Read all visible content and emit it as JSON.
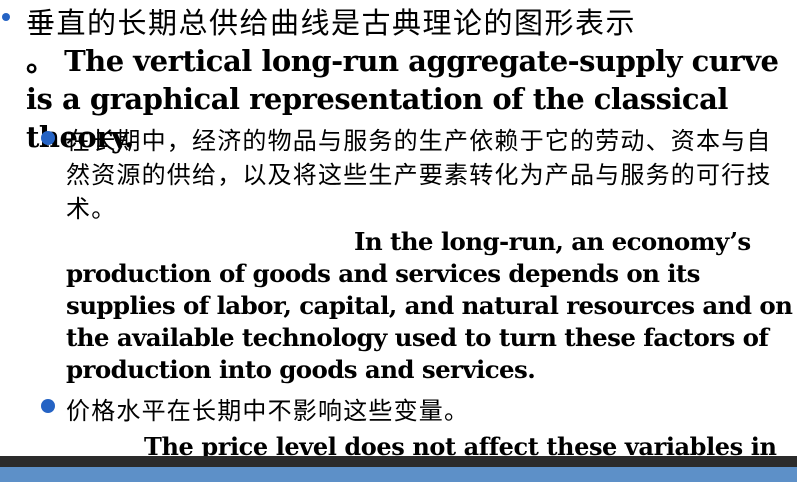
{
  "colors": {
    "bullet": "#2563c4",
    "footer_dark": "#2b2b2b",
    "footer_light": "#5d90c8",
    "text": "#000000"
  },
  "paragraph1": {
    "zh": "垂直的长期总供给曲线是古典理论的图形表示",
    "en": "。 The vertical long-run aggregate-supply curve is a graphical representation of the classical theory."
  },
  "paragraph2": {
    "zh": "在长期中，经济的物品与服务的生产依赖于它的劳动、资本与自然资源的供给，以及将这些生产要素转化为产品与服务的可行技术。",
    "en": "In the long-run, an economy’s production of goods and services depends on its supplies of labor, capital, and natural resources and on the available technology used to turn these factors of production into goods and services."
  },
  "paragraph3": {
    "zh": "价格水平在长期中不影响这些变量。",
    "en": "The price level does not affect these variables in"
  }
}
